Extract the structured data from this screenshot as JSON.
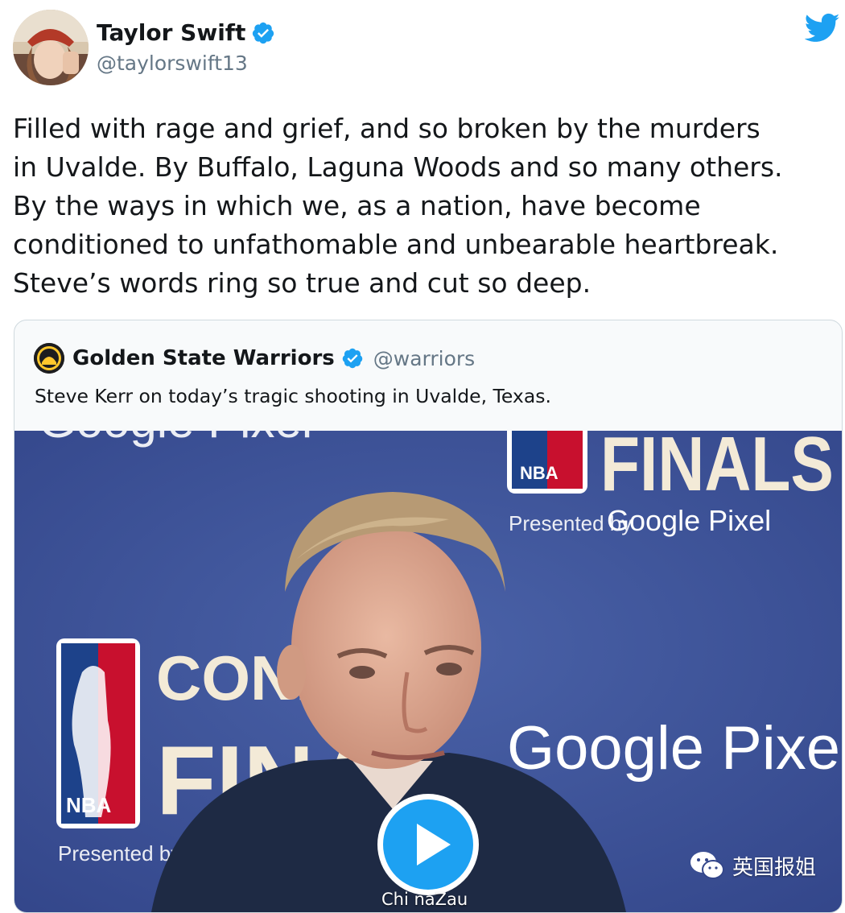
{
  "author": {
    "name": "Taylor Swift",
    "handle": "@taylorswift13"
  },
  "tweet": {
    "lines": [
      "Filled with rage and grief, and so broken by the murders",
      "in Uvalde. By Buffalo, Laguna Woods and so many others.",
      "By the ways in which we, as a nation, have become",
      "conditioned to unfathomable and unbearable heartbreak.",
      "Steve’s words ring so true and cut so deep."
    ]
  },
  "quoted": {
    "name": "Golden State Warriors",
    "handle": "@warriors",
    "text": "Steve Kerr on today’s tragic shooting in Uvalde, Texas."
  },
  "video": {
    "backdrop": {
      "top_left": "Google Pixel",
      "nba": "NBA",
      "finals": "FINALS",
      "presented_by": "Presented by",
      "google_pixel": "Google Pixel",
      "conference": "CONFER",
      "finals_left": "FINAL",
      "google_pixel_right": "Google Pixe",
      "presented_by_left": "Presented by"
    }
  },
  "watermarks": {
    "wechat": "英国报姐",
    "bottom": "Chi naZau"
  },
  "colors": {
    "twitter_blue": "#1da1f2",
    "backdrop_blue": "#3d5498",
    "nba_red": "#c8102e"
  }
}
